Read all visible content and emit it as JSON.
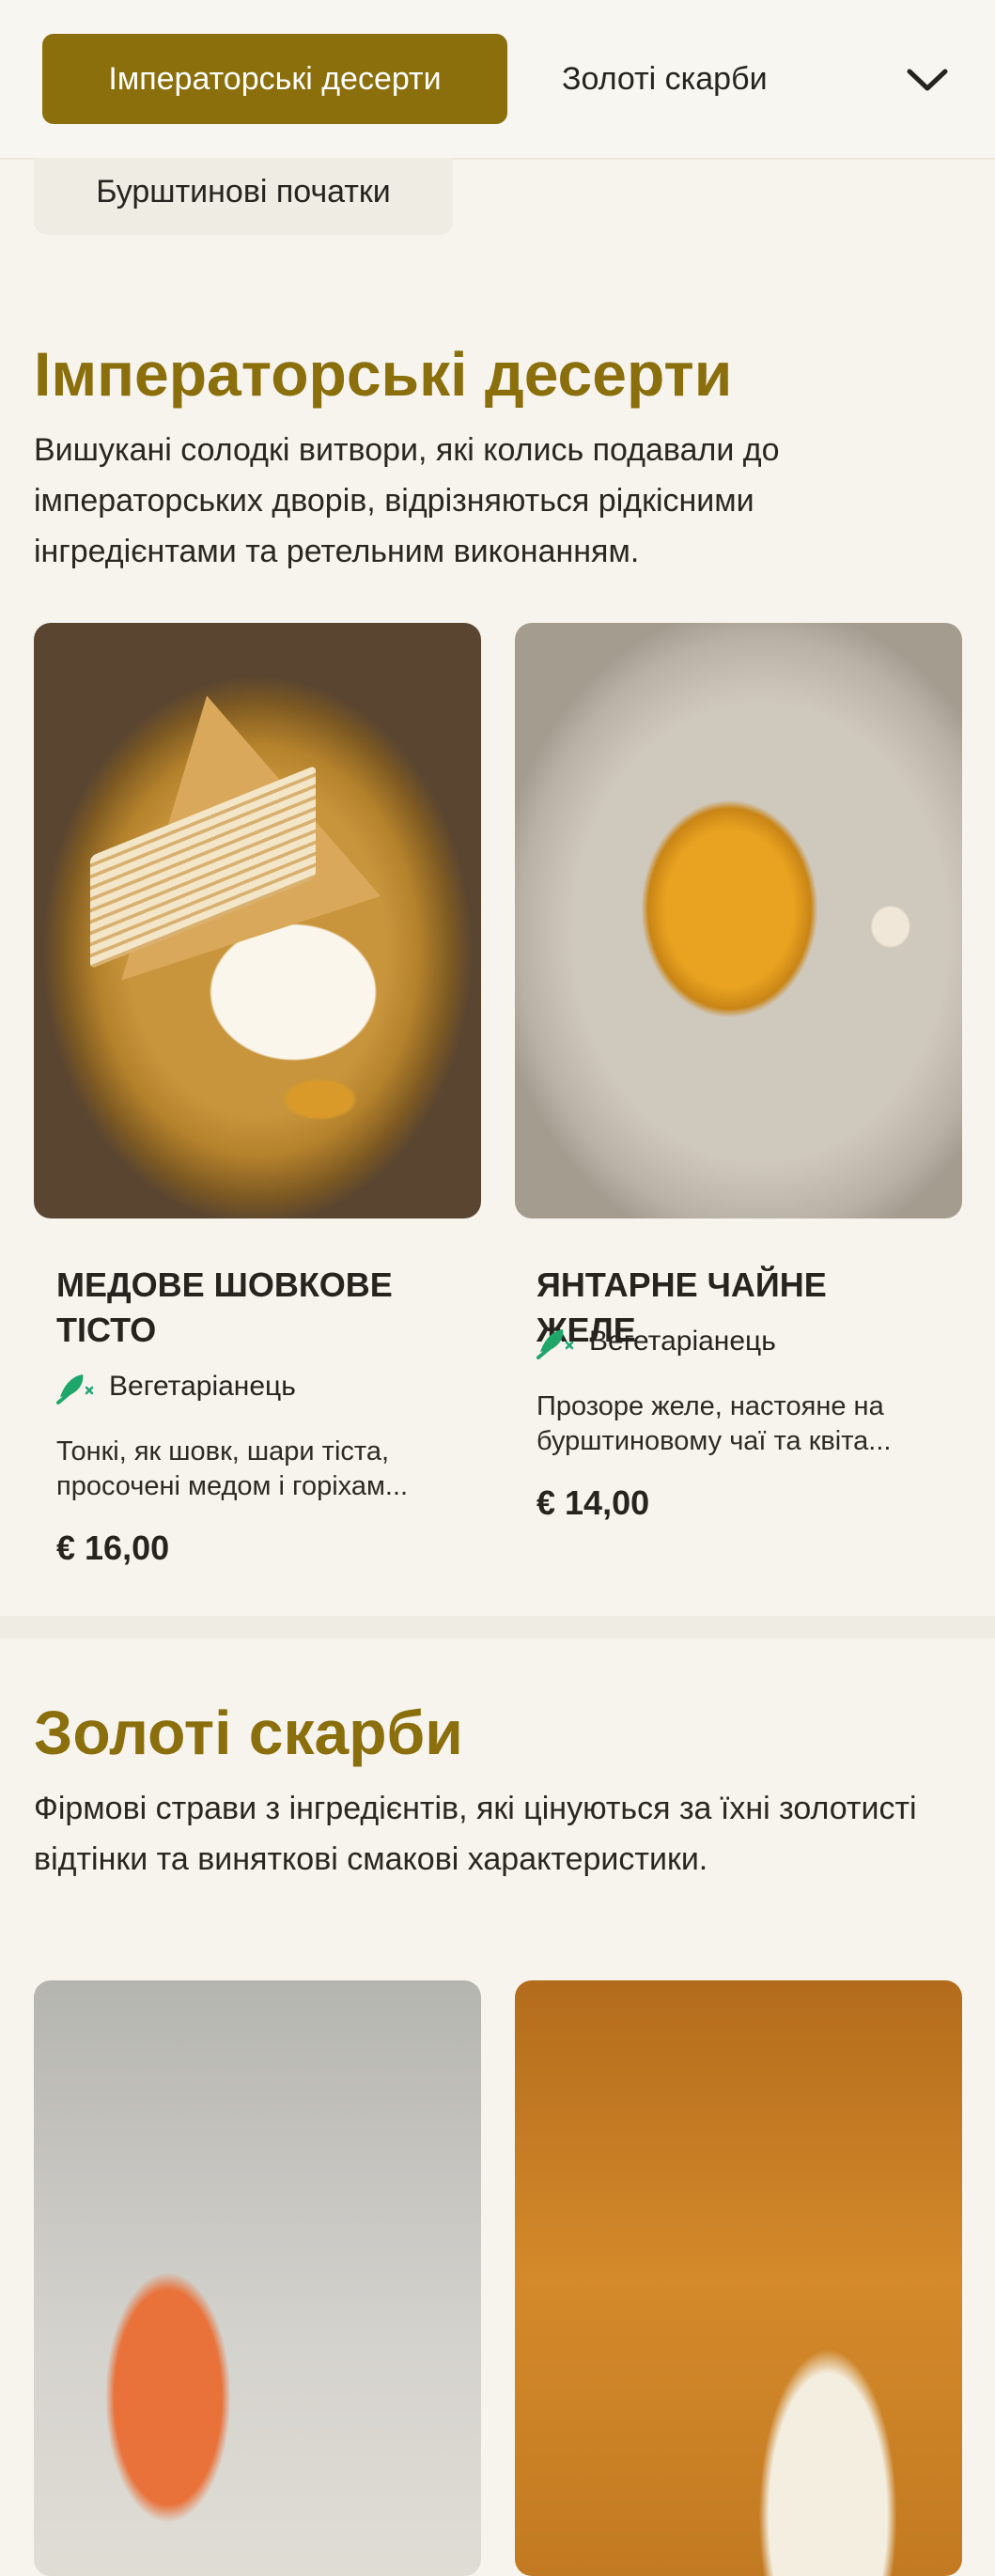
{
  "tabs": {
    "active": "Імператорські десерти",
    "second": "Золоті скарби",
    "third": "Бурштинові початки",
    "chevron": "chevron-down-icon"
  },
  "sections": [
    {
      "title": "Імператорські десерти",
      "description": "Вишукані солодкі витвори, які колись подавали до імператорських дворів, відрізняються рідкісними інгредієнтами та ретельним виконанням.",
      "dishes": [
        {
          "name": "МЕДОВЕ ШОВКОВЕ ТІСТО",
          "diet": "Вегетаріанець",
          "description": "Тонкі, як шовк, шари тіста, просочені медом і горіхам...",
          "price": "€ 16,00"
        },
        {
          "name": "ЯНТАРНЕ ЧАЙНЕ ЖЕЛЕ",
          "diet": "Вегетаріанець",
          "description": "Прозоре желе, настояне на бурштиновому чаї та квіта...",
          "price": "€ 14,00"
        }
      ]
    },
    {
      "title": "Золоті скарби",
      "description": "Фірмові страви з інгредієнтів, які цінуються за їхні золотисті відтінки та виняткові смакові характеристики."
    }
  ],
  "colors": {
    "accent": "#8a6f0c",
    "background": "#f7f4ee",
    "veg_icon": "#1fa66a"
  }
}
